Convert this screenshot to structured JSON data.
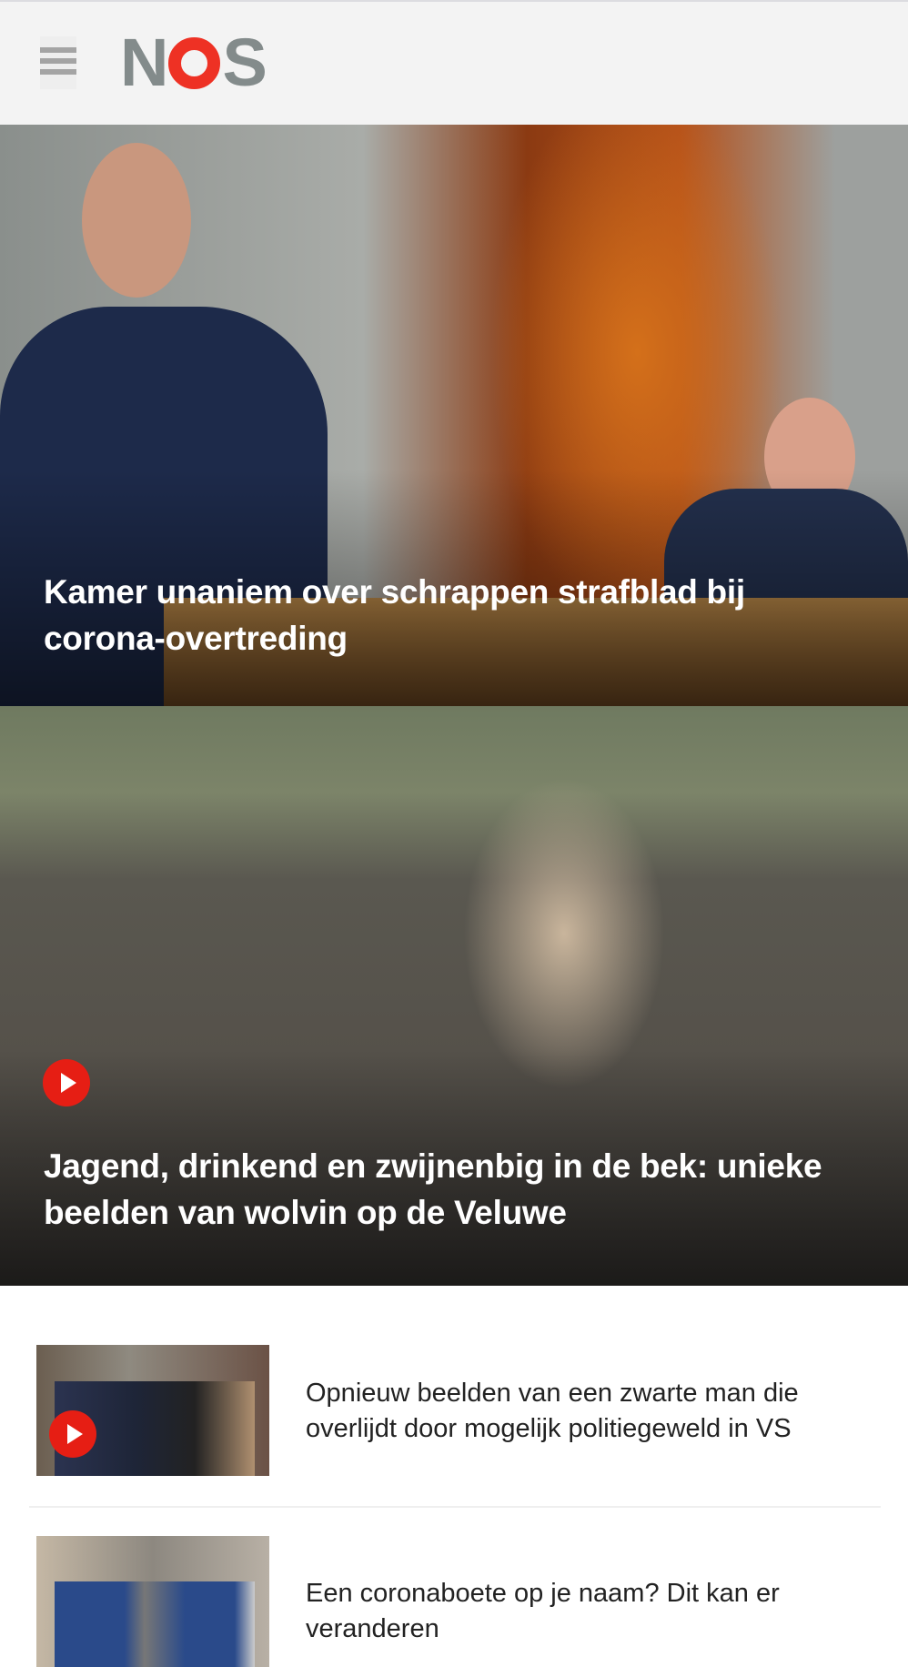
{
  "header": {
    "logo": "NOS",
    "menu_icon": "hamburger-icon"
  },
  "hero_articles": [
    {
      "title": "Kamer unaniem over schrappen strafblad bij corona-overtreding",
      "video": false
    },
    {
      "title": "Jagend, drinkend en zwijnenbig in de bek: unieke beelden van wolvin op de Veluwe",
      "video": true
    }
  ],
  "list_articles": [
    {
      "title": "Opnieuw beelden van een zwarte man die overlijdt door mogelijk politiegeweld in VS",
      "video": true
    },
    {
      "title": "Een coronaboete op je naam? Dit kan er veranderen",
      "video": false
    }
  ],
  "colors": {
    "brand_red": "#ee3124",
    "logo_gray": "#838b8b",
    "play_red": "#e61e14"
  }
}
